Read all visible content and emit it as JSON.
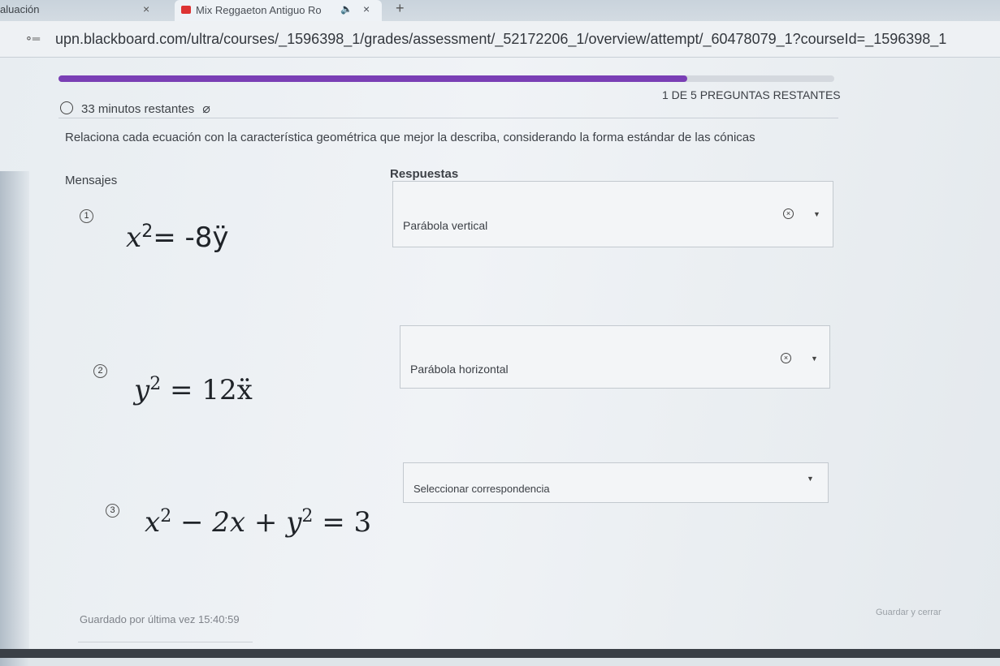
{
  "browser": {
    "active_tab_title": "aluación",
    "second_tab_title": "Mix Reggaeton Antiguo Ro",
    "close_glyph": "×",
    "new_tab_glyph": "+",
    "sound_glyph": "🔈",
    "url": "upn.blackboard.com/ultra/courses/_1596398_1/grades/assessment/_52172206_1/overview/attempt/_60478079_1?courseId=_1596398_1"
  },
  "assessment": {
    "progress_fraction": 0.81,
    "timer_text": "33 minutos restantes",
    "remaining_text": "1 DE 5 PREGUNTAS RESTANTES",
    "instruction": "Relaciona cada ecuación con la característica geométrica que mejor la describa, considerando la forma estándar de las cónicas",
    "messages_header": "Mensajes",
    "answers_header": "Respuestas",
    "items": [
      {
        "number": "1",
        "eq_base": "x",
        "eq_exp": "2",
        "eq_rest": "= -8ÿ",
        "answer": "Parábola vertical"
      },
      {
        "number": "2",
        "eq_base": "y",
        "eq_exp": "2",
        "eq_rest": " = 12ẍ",
        "answer": "Parábola horizontal"
      },
      {
        "number": "3",
        "eq_base": "x",
        "eq_exp": "2",
        "eq_rest": " − 2x + y",
        "eq_exp2": "2",
        "eq_rest2": " = 3",
        "answer": "Seleccionar correspondencia"
      }
    ],
    "saved_text": "Guardado por última vez 15:40:59",
    "save_exit_text": "Guardar y cerrar"
  }
}
